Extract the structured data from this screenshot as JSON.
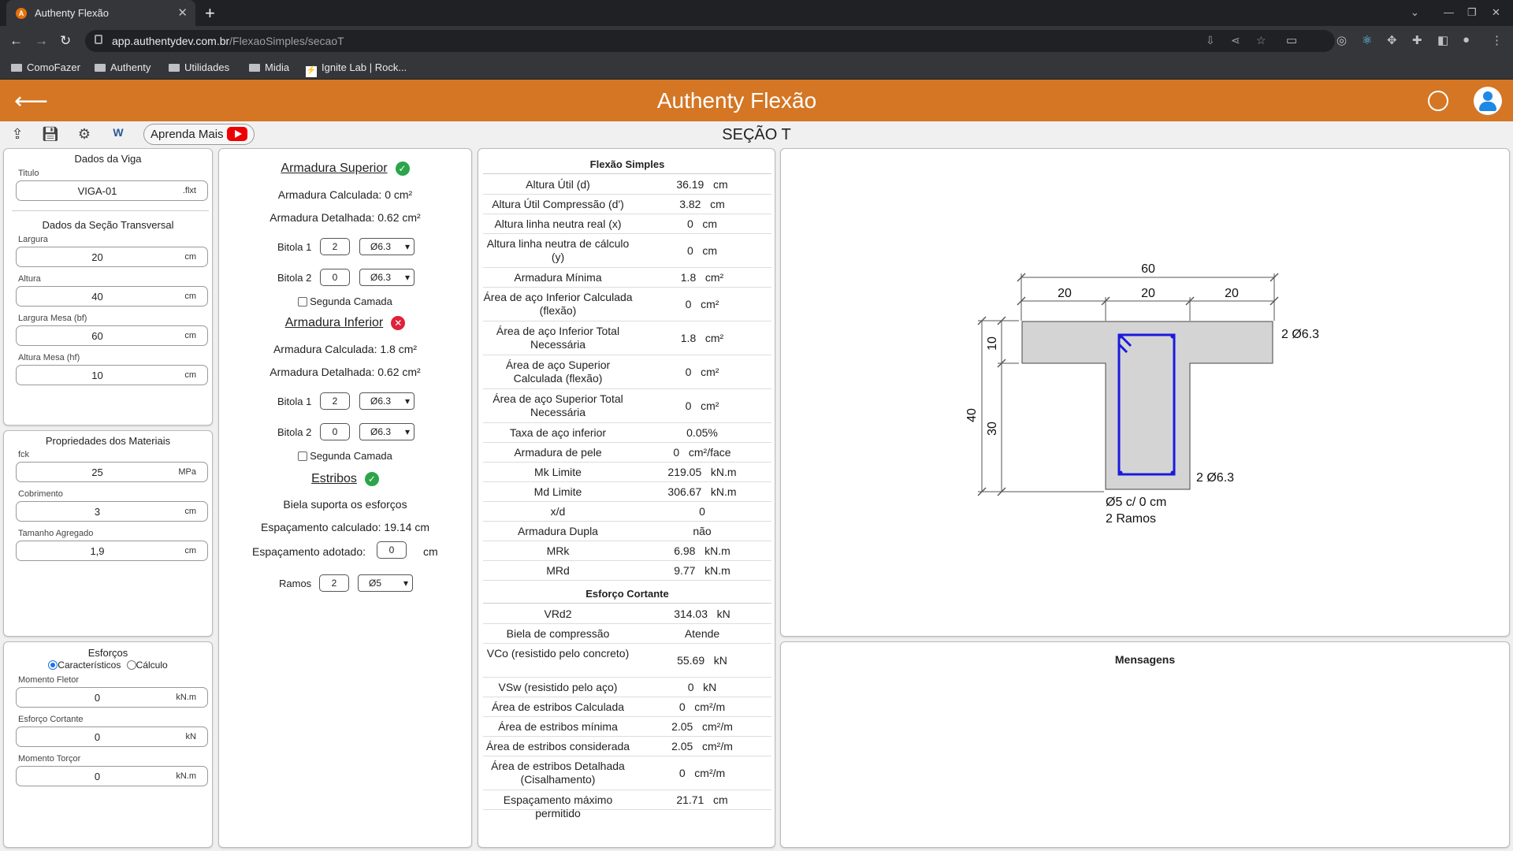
{
  "browser": {
    "tab_title": "Authenty Flexão",
    "tab_icon_letter": "A",
    "new_tab": "+",
    "close": "✕",
    "url_domain": "app.authentydev.com.br",
    "url_path": "/FlexaoSimples/secaoT",
    "bookmarks": [
      "ComoFazer",
      "Authenty",
      "Utilidades",
      "Midia",
      "Ignite Lab | Rock..."
    ]
  },
  "app": {
    "title": "Authenty Flexão",
    "section_title": "SEÇÃO T",
    "learn_more": "Aprenda Mais"
  },
  "viga": {
    "panel_title": "Dados da Viga",
    "titulo_label": "Titulo",
    "titulo_value": "VIGA-01",
    "titulo_ext": ".flxt",
    "secao_title": "Dados da Seção Transversal",
    "largura_label": "Largura",
    "largura_value": "20",
    "largura_unit": "cm",
    "altura_label": "Altura",
    "altura_value": "40",
    "altura_unit": "cm",
    "mesa_label": "Largura Mesa (bf)",
    "mesa_value": "60",
    "mesa_unit": "cm",
    "altmesa_label": "Altura Mesa (hf)",
    "altmesa_value": "10",
    "altmesa_unit": "cm"
  },
  "materiais": {
    "panel_title": "Propriedades dos Materiais",
    "fck_label": "fck",
    "fck_value": "25",
    "fck_unit": "MPa",
    "cob_label": "Cobrimento",
    "cob_value": "3",
    "cob_unit": "cm",
    "agr_label": "Tamanho Agregado",
    "agr_value": "1,9",
    "agr_unit": "cm"
  },
  "esforcos": {
    "panel_title": "Esforços",
    "radio_1": "Característicos",
    "radio_2": "Cálculo",
    "mf_label": "Momento Fletor",
    "mf_value": "0",
    "mf_unit": "kN.m",
    "ec_label": "Esforço Cortante",
    "ec_value": "0",
    "ec_unit": "kN",
    "mt_label": "Momento Torçor",
    "mt_value": "0",
    "mt_unit": "kN.m"
  },
  "armadura": {
    "sup_title": "Armadura Superior",
    "sup_calc": "Armadura Calculada:  0  cm²",
    "sup_det": "Armadura Detalhada:  0.62  cm²",
    "sup_b1_label": "Bitola 1",
    "sup_b1_n": "2",
    "sup_b1_d": "Ø6.3",
    "sup_b2_label": "Bitola 2",
    "sup_b2_n": "0",
    "sup_b2_d": "Ø6.3",
    "sup_camada": "Segunda Camada",
    "inf_title": "Armadura Inferior",
    "inf_calc": "Armadura Calculada:  1.8  cm²",
    "inf_det": "Armadura Detalhada:  0.62  cm²",
    "inf_b1_label": "Bitola 1",
    "inf_b1_n": "2",
    "inf_b1_d": "Ø6.3",
    "inf_b2_label": "Bitola 2",
    "inf_b2_n": "0",
    "inf_b2_d": "Ø6.3",
    "inf_camada": "Segunda Camada",
    "est_title": "Estribos",
    "est_biela": "Biela suporta os esforços",
    "est_esp_calc": "Espaçamento calculado:  19.14   cm",
    "est_esp_adot_label": "Espaçamento adotado:",
    "est_esp_adot_value": "0",
    "est_esp_adot_unit": "cm",
    "ramos_label": "Ramos",
    "ramos_n": "2",
    "ramos_d": "Ø5"
  },
  "flexao": {
    "title": "Flexão Simples",
    "rows": [
      {
        "k": "Altura Útil (d)",
        "v": "36.19   cm"
      },
      {
        "k": "Altura Útil Compressão (d')",
        "v": "3.82   cm"
      },
      {
        "k": "Altura linha neutra real (x)",
        "v": "0   cm"
      },
      {
        "k": "Altura linha neutra de cálculo (y)",
        "v": "0   cm"
      },
      {
        "k": "Armadura Mínima",
        "v": "1.8   cm²"
      },
      {
        "k": "Área de aço Inferior Calculada (flexão)",
        "v": "0   cm²"
      },
      {
        "k": "Área de aço Inferior Total Necessária",
        "v": "1.8   cm²"
      },
      {
        "k": "Área de aço Superior Calculada (flexão)",
        "v": "0   cm²"
      },
      {
        "k": "Área de aço Superior Total Necessária",
        "v": "0   cm²"
      },
      {
        "k": "Taxa de aço inferior",
        "v": "0.05%"
      },
      {
        "k": "Armadura de pele",
        "v": "0   cm²/face"
      },
      {
        "k": "Mk Limite",
        "v": "219.05   kN.m"
      },
      {
        "k": "Md Limite",
        "v": "306.67   kN.m"
      },
      {
        "k": "x/d",
        "v": "0"
      },
      {
        "k": "Armadura Dupla",
        "v": "não"
      },
      {
        "k": "MRk",
        "v": "6.98   kN.m"
      },
      {
        "k": "MRd",
        "v": "9.77   kN.m"
      }
    ]
  },
  "cortante": {
    "title": "Esforço Cortante",
    "rows": [
      {
        "k": "VRd2",
        "v": "314.03   kN"
      },
      {
        "k": "Biela de compressão",
        "v": "Atende"
      },
      {
        "k": "VCo (resistido pelo concreto)",
        "v": "55.69   kN"
      },
      {
        "k": "VSw (resistido pelo aço)",
        "v": "0   kN"
      },
      {
        "k": "Área de estribos Calculada",
        "v": "0   cm²/m"
      },
      {
        "k": "Área de estribos mínima",
        "v": "2.05   cm²/m"
      },
      {
        "k": "Área de estribos considerada",
        "v": "2.05   cm²/m"
      },
      {
        "k": "Área de estribos Detalhada (Cisalhamento)",
        "v": "0   cm²/m"
      },
      {
        "k": "Espaçamento máximo permitido",
        "v": "21.71   cm"
      }
    ]
  },
  "desenho": {
    "bf": "60",
    "b1": "20",
    "b2": "20",
    "b3": "20",
    "h_total": "40",
    "hf": "10",
    "h_alma": "30",
    "top_bars": "2 Ø6.3",
    "bottom_bars": "2 Ø6.3",
    "stirrup": "Ø5 c/ 0 cm",
    "ramos": "2 Ramos"
  },
  "mensagens": {
    "title": "Mensagens"
  },
  "colors": {
    "header": "#d47624",
    "ok": "#2ca44a",
    "error": "#e0203a",
    "rebar": "#1a1adf",
    "concrete": "#d4d4d4"
  }
}
